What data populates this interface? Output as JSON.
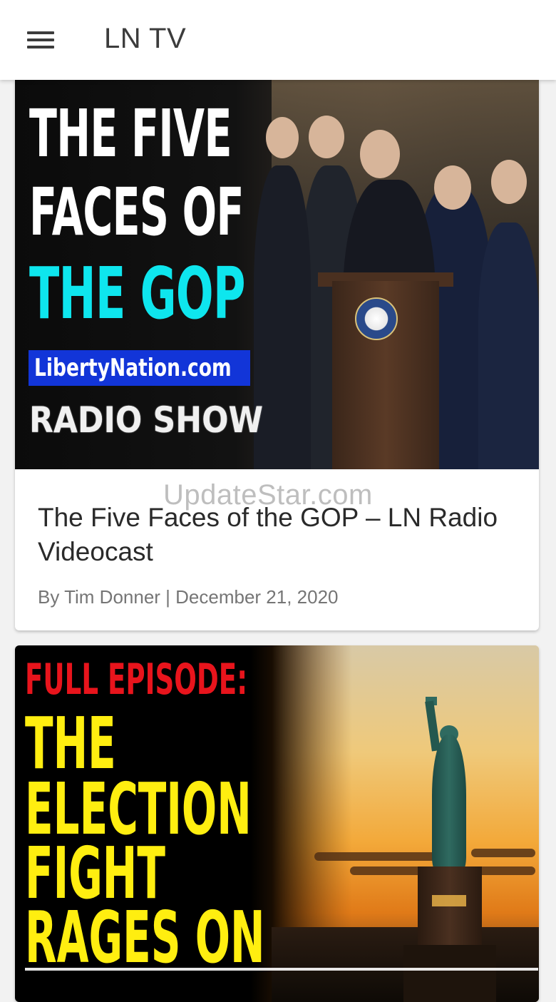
{
  "appbar": {
    "title": "LN TV",
    "menu_icon": "hamburger-menu-icon"
  },
  "articles": [
    {
      "thumbnail_lines": [
        "THE FIVE",
        "FACES OF",
        "THE GOP"
      ],
      "thumbnail_badge": "LibertyNation.com",
      "thumbnail_footer": "RADIO SHOW",
      "watermark": "UpdateStar.com",
      "title": "The Five Faces of the GOP – LN Radio Videocast",
      "meta": "By Tim Donner | December 21, 2020"
    },
    {
      "thumbnail_lines": [
        "FULL EPISODE:",
        "THE",
        "ELECTION",
        "FIGHT",
        "RAGES ON"
      ]
    }
  ],
  "colors": {
    "appbar_bg": "#ffffff",
    "page_bg": "#f2f2f2",
    "cyan_headline": "#0ee6ee",
    "badge_blue": "#1235d8",
    "yellow_headline": "#ffee10",
    "red_headline": "#e8141c"
  }
}
